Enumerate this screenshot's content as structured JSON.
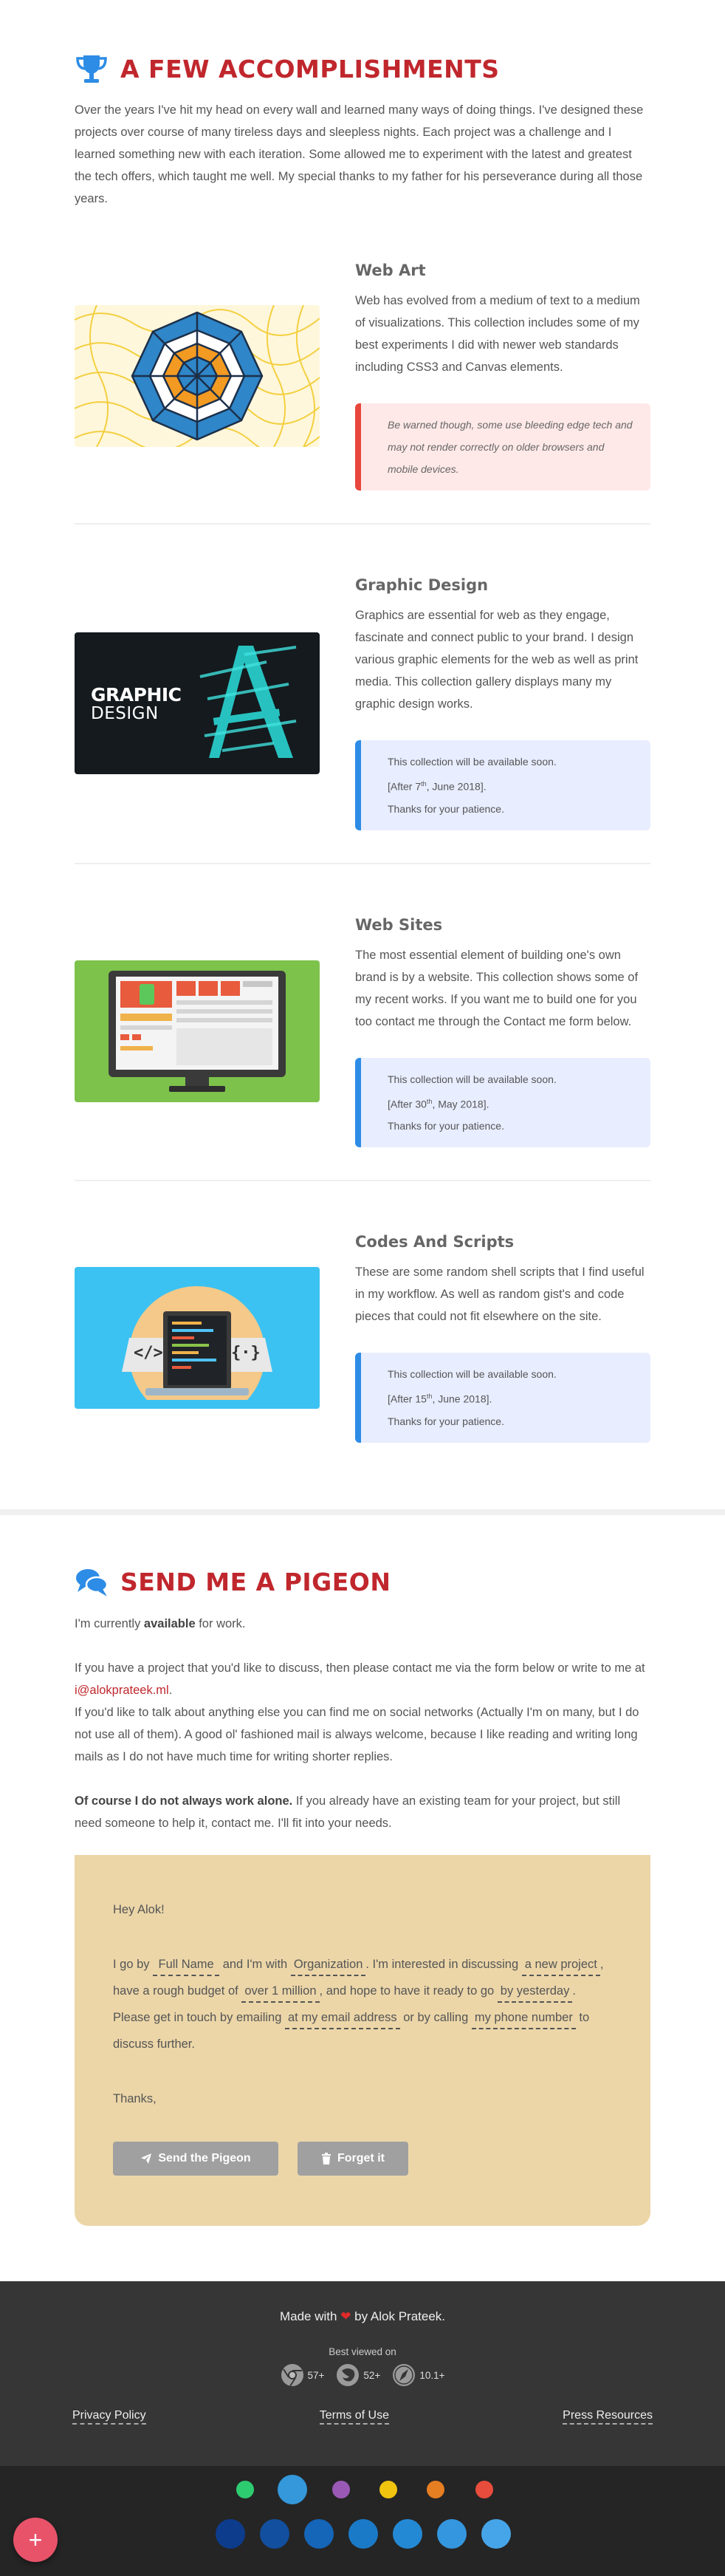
{
  "accomplishments": {
    "icon": "trophy-icon",
    "title": "A FEW ACCOMPLISHMENTS",
    "intro": "Over the years I've hit my head on every wall and learned many ways of doing things. I've designed these projects over course of many tireless days and sleepless nights. Each project was a challenge and I learned something new with each iteration. Some allowed me to experiment with the latest and greatest the tech offers, which taught me well. My special thanks to my father for his perseverance during all those years.",
    "projects": [
      {
        "title": "Web Art",
        "description": "Web has evolved from a medium of text to a medium of visualizations. This collection includes some of my best experiments I did with newer web standards including CSS3 and Canvas elements.",
        "notice": "Be warned though, some use bleeding edge tech and may not render correctly on older browsers and mobile devices."
      },
      {
        "title": "Graphic Design",
        "description": "Graphics are essential for web as they engage, fascinate and connect public to your brand. I design various graphic elements for the web as well as print media. This collection gallery displays many my graphic design works.",
        "notice_line1": "This collection will be available soon.",
        "notice_date_pre": "[After 7",
        "notice_date_sup": "th",
        "notice_date_post": ", June 2018].",
        "notice_line3": "Thanks for your patience.",
        "thumb_text_1": "GRAPHIC",
        "thumb_text_2": "DESIGN"
      },
      {
        "title": "Web Sites",
        "description": "The most essential element of building one's own brand is by a website. This collection shows some of my recent works. If you want me to build one for you too contact me through the Contact me form below.",
        "notice_line1": "This collection will be available soon.",
        "notice_date_pre": "[After 30",
        "notice_date_sup": "th",
        "notice_date_post": ", May 2018].",
        "notice_line3": "Thanks for your patience."
      },
      {
        "title": "Codes And Scripts",
        "description": "These are some random shell scripts that I find useful in my workflow. As well as random gist's and code pieces that could not fit elsewhere on the site.",
        "notice_line1": "This collection will be available soon.",
        "notice_date_pre": "[After 15",
        "notice_date_sup": "th",
        "notice_date_post": ", June 2018].",
        "notice_line3": "Thanks for your patience.",
        "thumb_left": "</>",
        "thumb_right": "{·}"
      }
    ]
  },
  "contact": {
    "icon": "chat-bubbles-icon",
    "title": "SEND ME A PIGEON",
    "availability_pre": "I'm currently ",
    "availability_bold": "available",
    "availability_post": " for work.",
    "para1_pre": "If you have a project that you'd like to discuss, then please contact me via the form below or write to me at ",
    "email": "i@alokprateek.ml",
    "para1_post": ".",
    "para2": "If you'd like to talk about anything else you can find me on social networks (Actually I'm on many, but I do not use all of them). A good ol' fashioned mail is always welcome, because I like reading and writing long mails as I do not have much time for writing shorter replies.",
    "para3_bold": "Of course I do not always work alone.",
    "para3_rest": " If you already have an existing team for your project, but still need someone to help it, contact me. I'll fit into your needs.",
    "form": {
      "greeting": "Hey Alok!",
      "t1": "I go by ",
      "name_placeholder": "Full Name",
      "t2": " and I'm with ",
      "org_placeholder": "Organization",
      "t3": ". I'm interested in discussing ",
      "project_value": "a new project",
      "t4": ", have a rough budget of ",
      "budget_value": "over 1 million",
      "t5": ", and hope to have it ready to go ",
      "timeline_value": "by yesterday",
      "t6": ". Please get in touch by emailing ",
      "email_placeholder": "at my email address",
      "t7": " or by calling ",
      "phone_placeholder": "my phone number",
      "t8": " to discuss further.",
      "closing": "Thanks,",
      "send_label": "Send the Pigeon",
      "forget_label": "Forget it"
    }
  },
  "footer": {
    "made_with_pre": "Made with ",
    "made_with_post": " by Alok Prateek.",
    "best_viewed": "Best viewed on",
    "browsers": [
      {
        "icon": "chrome-icon",
        "version": "57+"
      },
      {
        "icon": "firefox-icon",
        "version": "52+"
      },
      {
        "icon": "safari-icon",
        "version": "10.1+"
      }
    ],
    "links": [
      "Privacy Policy",
      "Terms of Use",
      "Press Resources"
    ]
  },
  "theme_palette": {
    "accent_colors": [
      "#2ecc71",
      "#3498db",
      "#9b59b6",
      "#f1c40f",
      "#e67e22",
      "#e74c3c"
    ],
    "shade_colors": [
      "#0d3c8c",
      "#124f9e",
      "#1565b8",
      "#1a7ac8",
      "#2489d4",
      "#3496de",
      "#46a5e8"
    ],
    "selected_accent": "#3498db"
  },
  "fab": {
    "icon": "plus-icon",
    "label": "+"
  },
  "colors": {
    "accent_red": "#c0272d",
    "accent_blue": "#2d8ce6",
    "footer_bg": "#363636"
  }
}
